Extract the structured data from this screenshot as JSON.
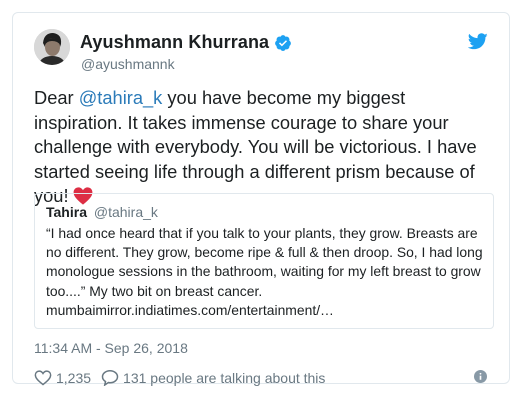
{
  "author": {
    "display_name": "Ayushmann Khurrana",
    "handle": "@ayushmannk",
    "avatar_icon": "profile-photo",
    "verified_icon": "verified-badge-icon"
  },
  "brand_icon": "twitter-bird-icon",
  "tweet": {
    "line1_pre": "Dear ",
    "mention": "@tahira_k",
    "line1_post": " you have become my biggest inspiration. It takes immense  courage to share your challenge with everybody. You will be victorious. I have started seeing life through a different prism because of you!",
    "emoji": "red-heart-icon"
  },
  "quote": {
    "name": "Tahira",
    "handle": "@tahira_k",
    "body": "“I had once heard that if you talk to your plants, they grow. Breasts are no different. They grow, become ripe & full & then droop. So, I had long monologue sessions in the bathroom, waiting for my left breast to grow too....” My two bit on breast cancer. mumbaimirror.indiatimes.com/entertainment/…"
  },
  "timestamp": "11:34 AM - Sep 26, 2018",
  "actions": {
    "likes": "1,235",
    "conversation": "131 people are talking about this"
  },
  "colors": {
    "accent": "#2b7bb9",
    "verified": "#1da1f2",
    "secondary_text": "#697882",
    "border": "#e1e8ed",
    "heart": "#e0245e"
  }
}
